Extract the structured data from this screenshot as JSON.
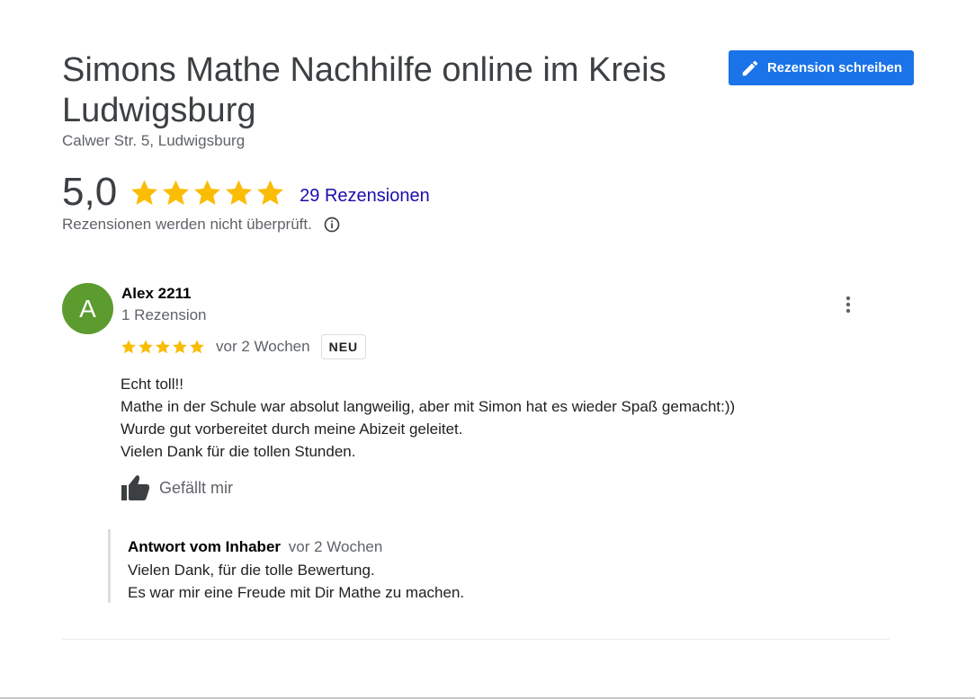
{
  "header": {
    "title": "Simons Mathe Nachhilfe online im Kreis Ludwigsburg",
    "address": "Calwer Str. 5, Ludwigsburg",
    "write_review_label": "Rezension schreiben"
  },
  "rating": {
    "value": "5,0",
    "stars": 5,
    "reviews_link": "29 Rezensionen",
    "disclaimer": "Rezensionen werden nicht überprüft."
  },
  "review": {
    "avatar_letter": "A",
    "reviewer": "Alex 2211",
    "reviewer_count": "1 Rezension",
    "stars": 5,
    "date": "vor 2 Wochen",
    "badge": "NEU",
    "text_lines": [
      "Echt toll!!",
      "Mathe in der Schule war absolut langweilig, aber mit Simon hat es wieder Spaß gemacht:))",
      "Wurde gut vorbereitet durch meine Abizeit geleitet.",
      "Vielen Dank für die tollen Stunden."
    ],
    "like_label": "Gefällt mir"
  },
  "owner_reply": {
    "label": "Antwort vom Inhaber",
    "date": "vor 2 Wochen",
    "lines": [
      "Vielen Dank, für die tolle Bewertung.",
      "Es war mir eine Freude mit Dir Mathe zu machen."
    ]
  },
  "colors": {
    "star": "#fbbc04",
    "button": "#1a73e8",
    "link": "#1a0dab",
    "avatar": "#5c9c2f"
  },
  "icons": {
    "write_button": "pencil-icon",
    "disclaimer": "info-icon",
    "more": "more-vert-icon",
    "like": "thumb-up-icon",
    "star": "star-icon"
  }
}
